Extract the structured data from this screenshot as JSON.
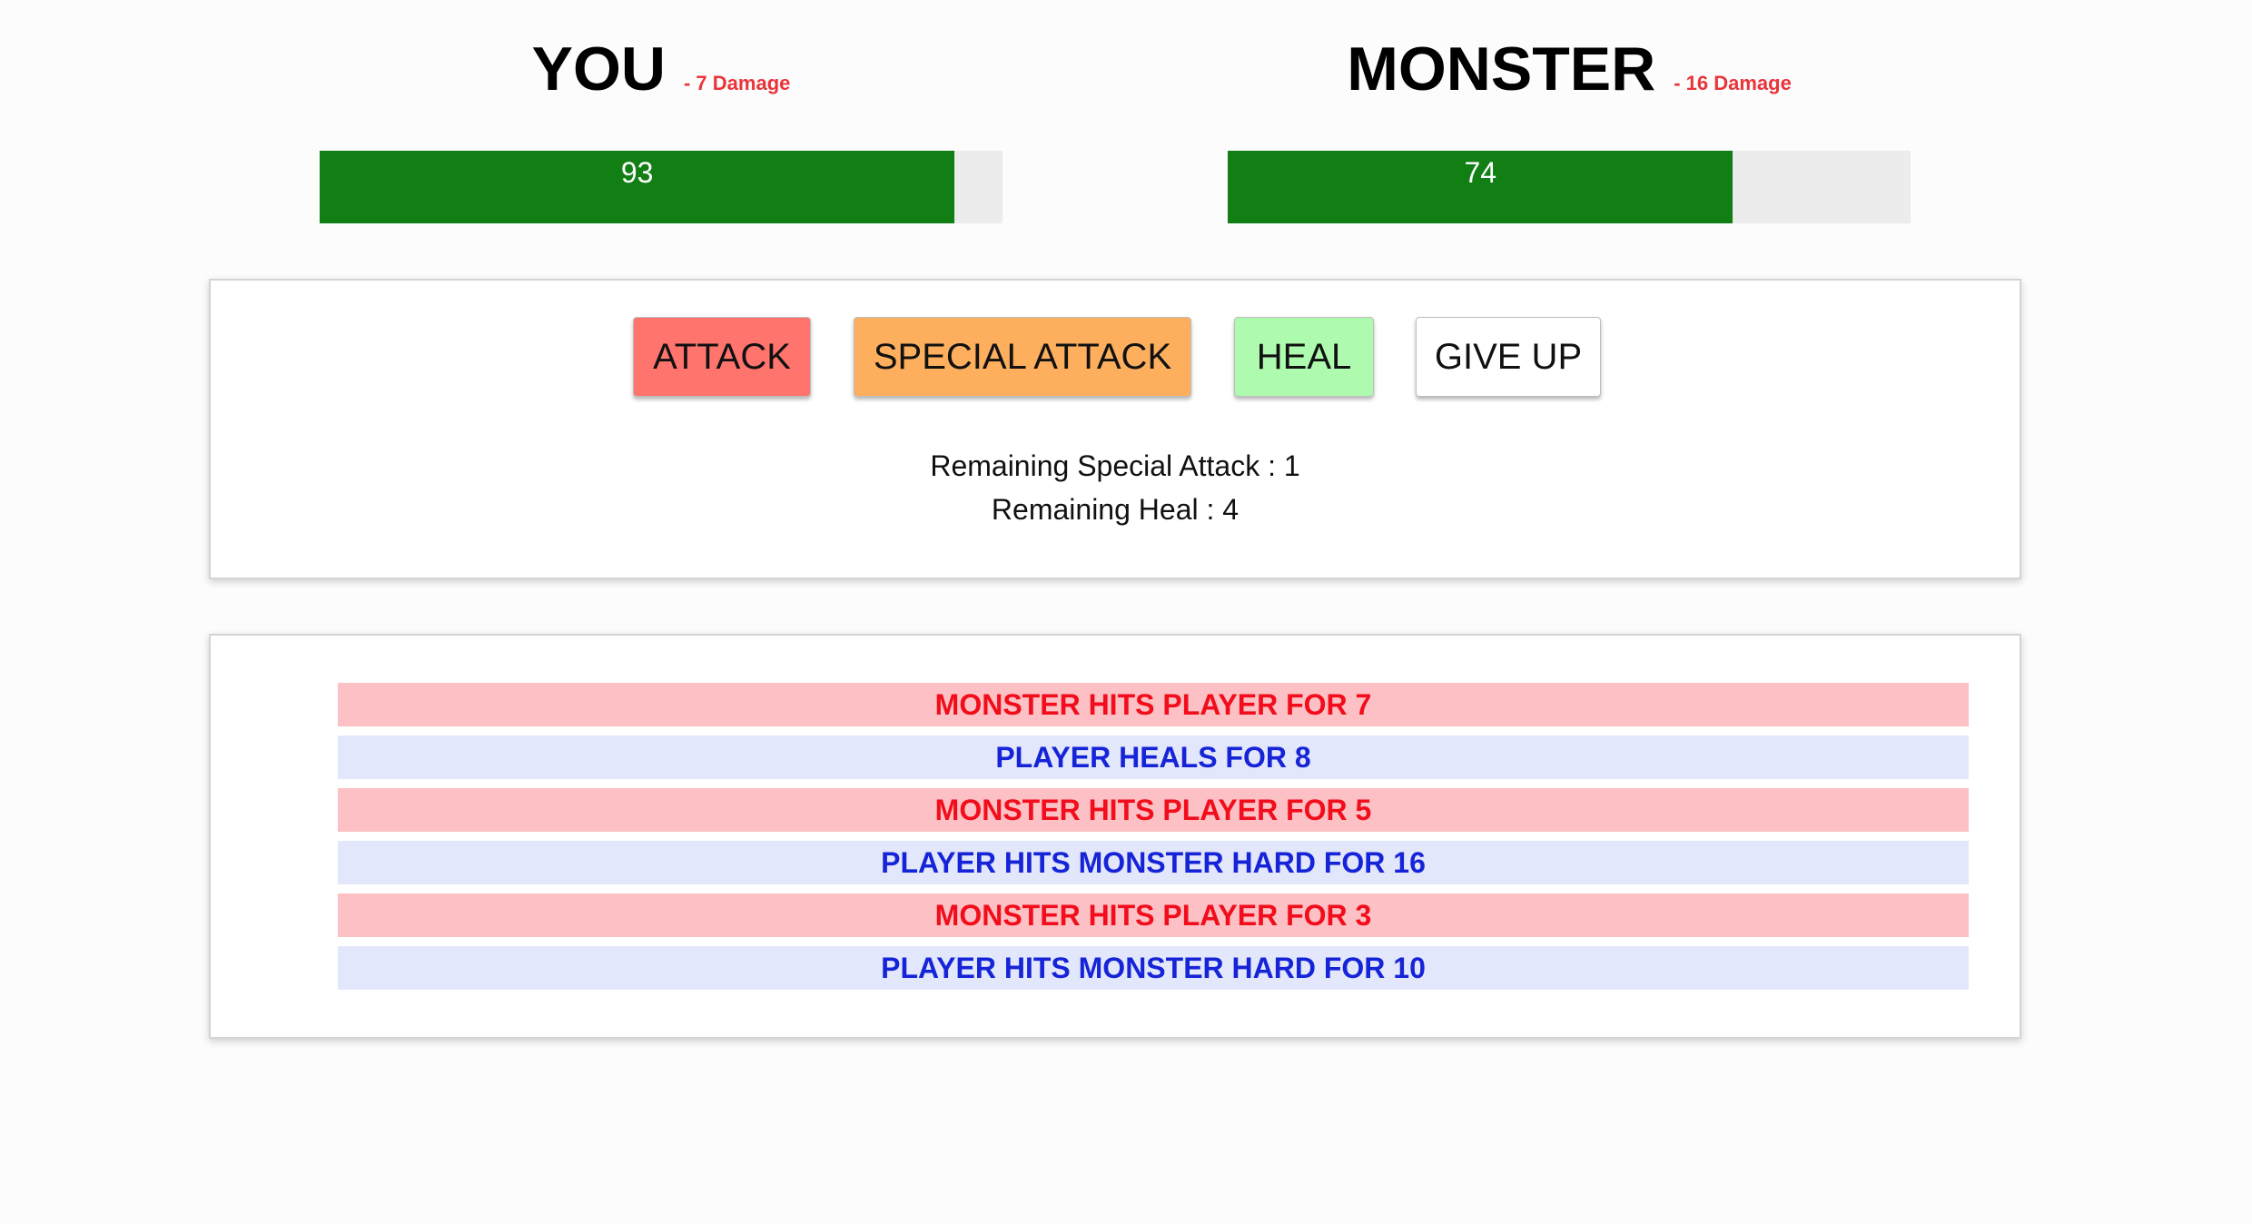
{
  "player": {
    "name": "YOU",
    "damage_text": "- 7 Damage",
    "health": 93,
    "health_label": "93"
  },
  "monster": {
    "name": "MONSTER",
    "damage_text": "- 16 Damage",
    "health": 74,
    "health_label": "74"
  },
  "controls": {
    "attack_label": "ATTACK",
    "special_attack_label": "SPECIAL ATTACK",
    "heal_label": "HEAL",
    "give_up_label": "GIVE UP",
    "remaining_special_attack": "Remaining Special Attack : 1",
    "remaining_heal": "Remaining Heal : 4"
  },
  "log": [
    {
      "text": "MONSTER HITS PLAYER FOR 7",
      "actor": "monster"
    },
    {
      "text": "PLAYER HEALS FOR 8",
      "actor": "player"
    },
    {
      "text": "MONSTER HITS PLAYER FOR 5",
      "actor": "monster"
    },
    {
      "text": "PLAYER HITS MONSTER HARD FOR 16",
      "actor": "player"
    },
    {
      "text": "MONSTER HITS PLAYER FOR 3",
      "actor": "monster"
    },
    {
      "text": "PLAYER HITS MONSTER HARD FOR 10",
      "actor": "player"
    }
  ],
  "colors": {
    "health_fill": "#117f14",
    "health_track": "#ececec",
    "damage_text": "#e8343a",
    "attack_button": "#ff746d",
    "special_attack_button": "#fdaf5e",
    "heal_button": "#aefaae",
    "give_up_button": "#ffffff",
    "monster_log_bg": "#fdc0c4",
    "monster_log_text": "#f10d1b",
    "player_log_bg": "#e3e7fb",
    "player_log_text": "#1624d8"
  }
}
